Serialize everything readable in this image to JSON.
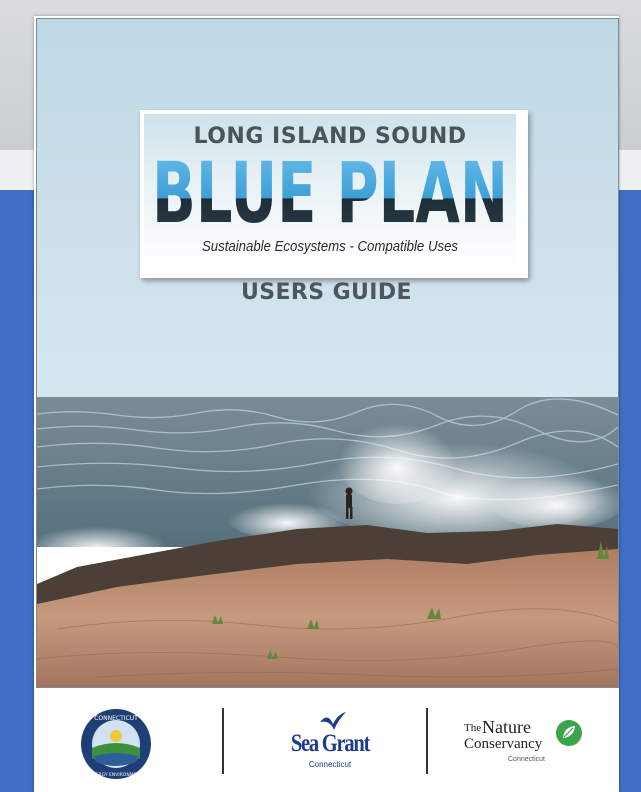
{
  "cover": {
    "kicker": "LONG ISLAND SOUND",
    "title": "BLUE PLAN",
    "tagline": "Sustainable Ecosystems - Compatible Uses",
    "subtitle": "USERS GUIDE"
  },
  "partners": {
    "ct_deep": {
      "top_text": "CONNECTICUT",
      "bottom_text": "ENERGY ENVIRONMENT"
    },
    "sea_grant": {
      "name": "Sea Grant",
      "sub": "Connecticut"
    },
    "tnc": {
      "the": "The",
      "nature": "Nature",
      "conservancy": "Conservancy",
      "sub": "Connecticut"
    }
  },
  "colors": {
    "title_blue": "#3e9fd8",
    "title_dark": "#1e2e38",
    "page_blue": "#3f6ec4",
    "sea_grant_blue": "#1c3c8c",
    "tnc_green": "#3aa54b"
  }
}
